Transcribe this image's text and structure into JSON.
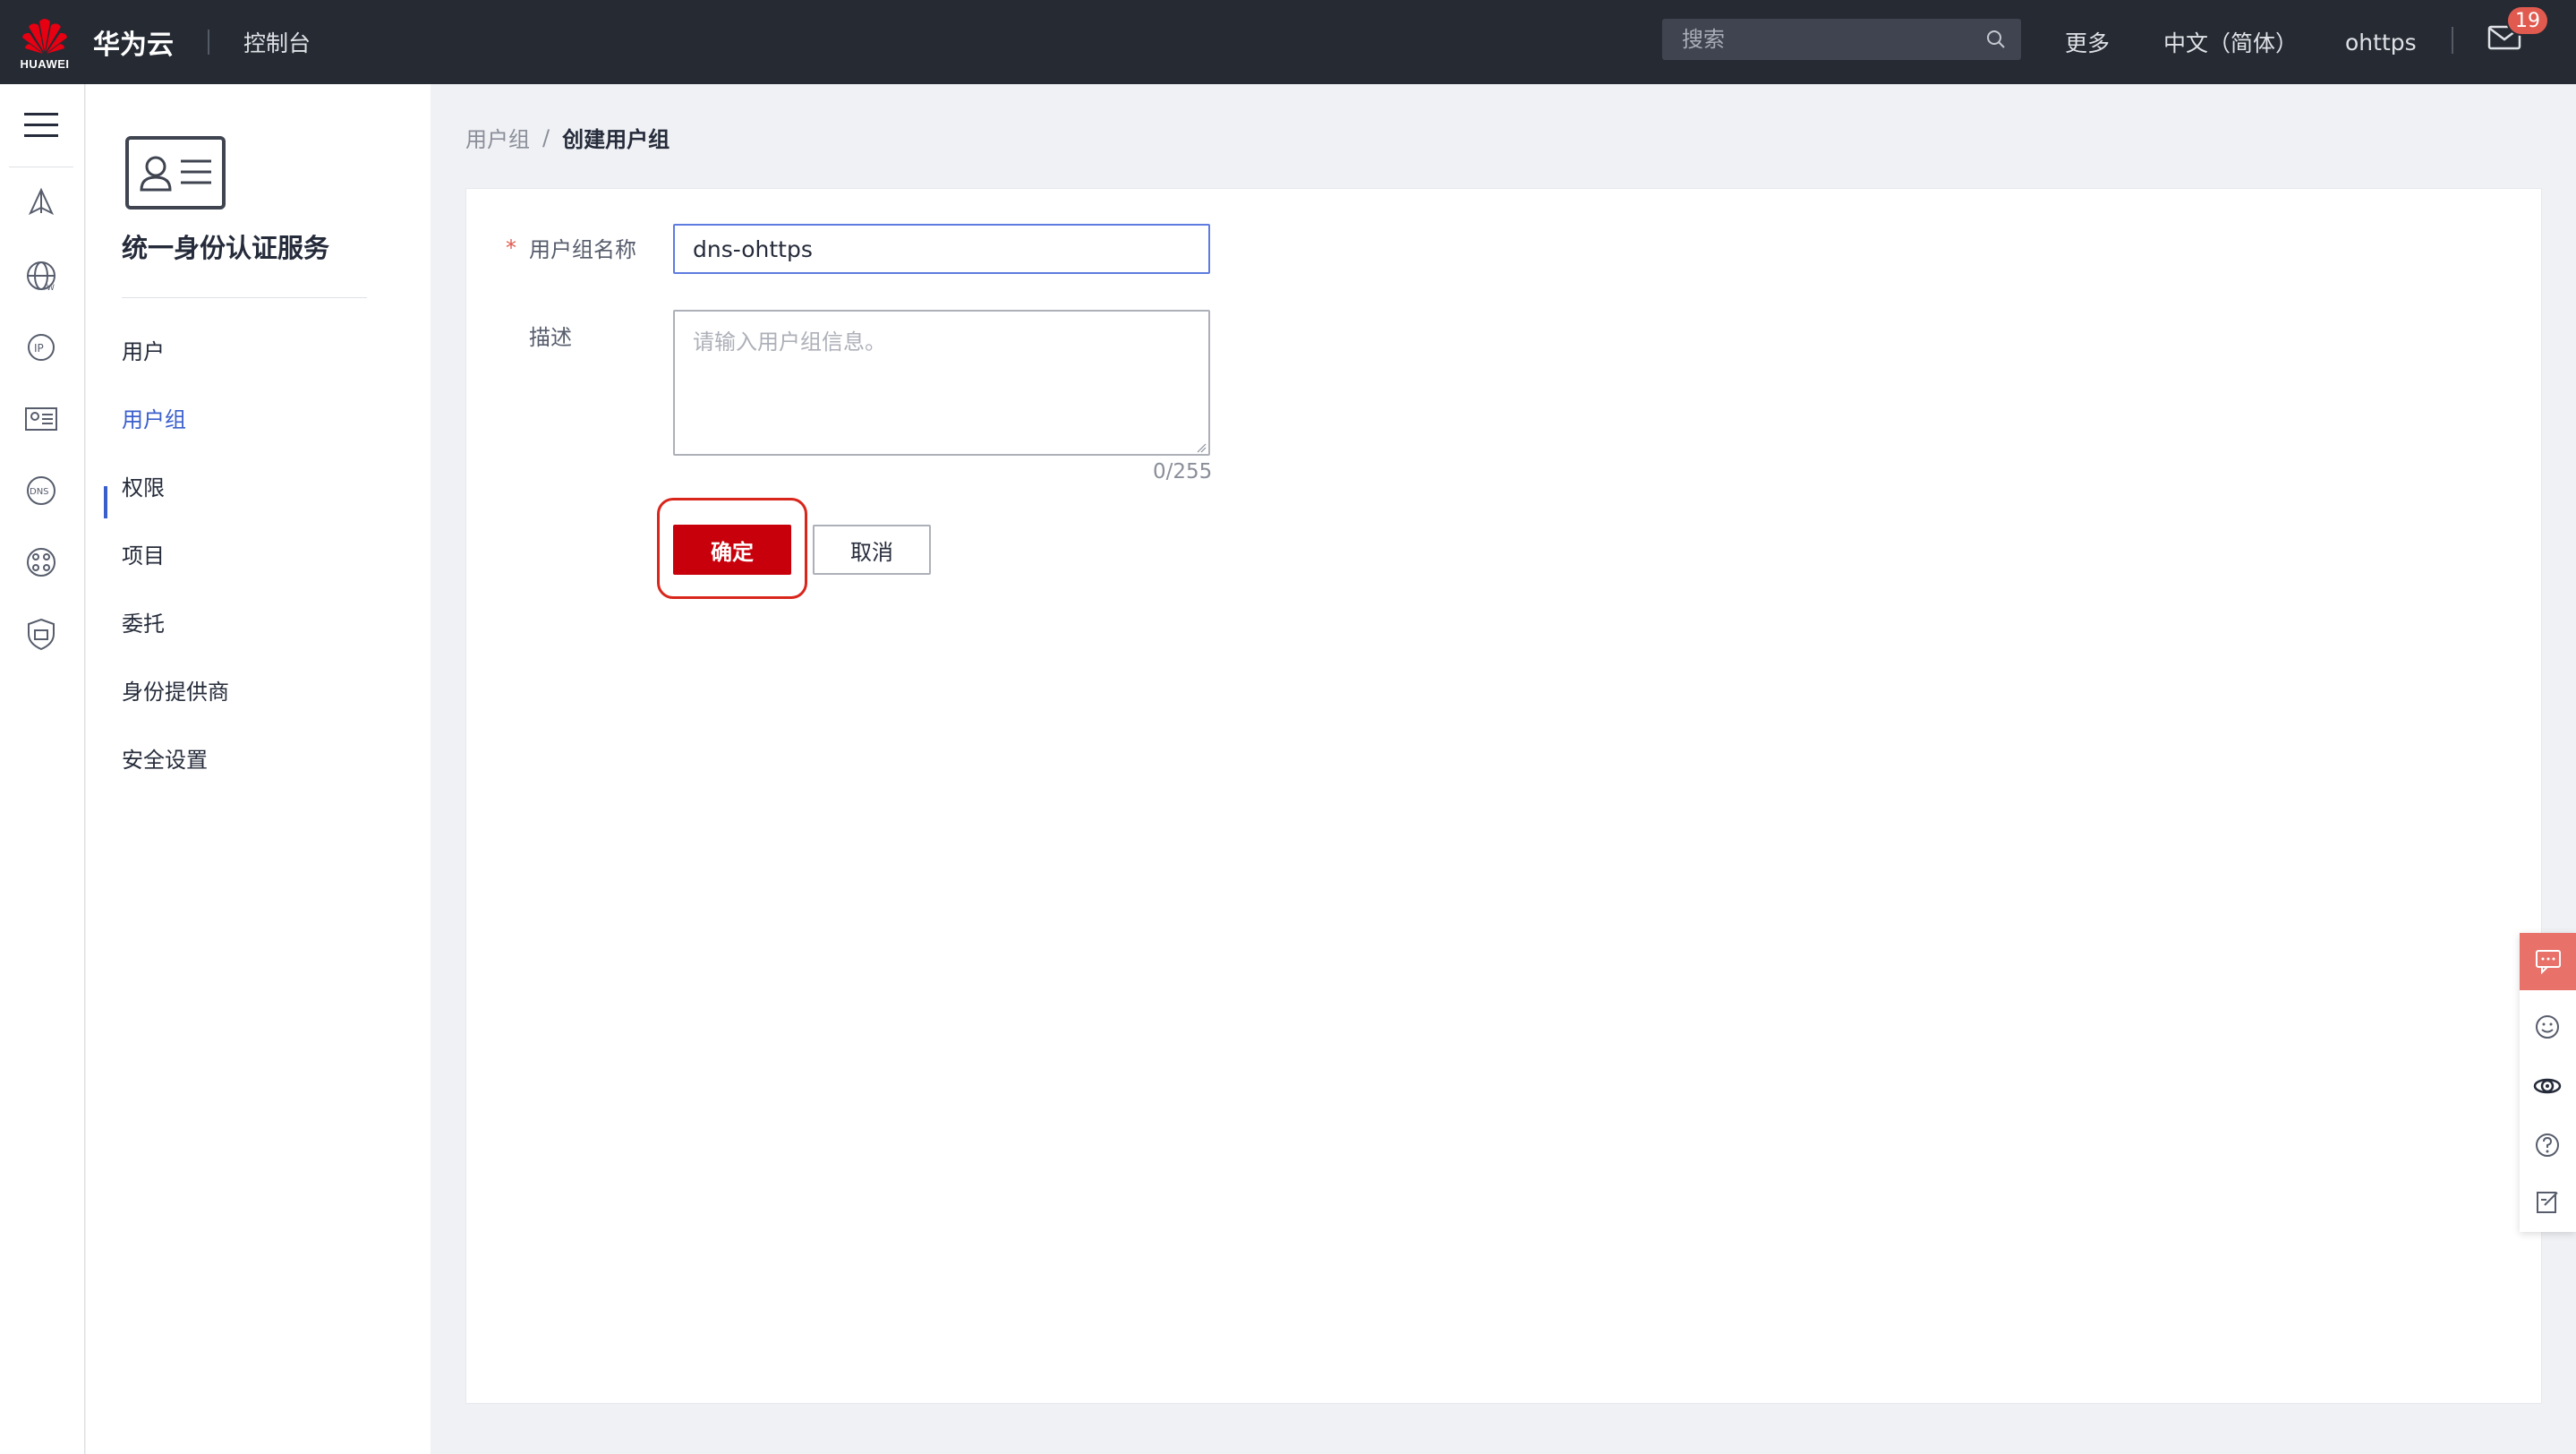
{
  "topbar": {
    "brand": "HUAWEI",
    "cloud_title": "华为云",
    "console": "控制台",
    "search_placeholder": "搜索",
    "more": "更多",
    "language": "中文（简体）",
    "username": "ohttps",
    "mail_badge": "19",
    "background": "#252a33"
  },
  "rail": {
    "icons": [
      "menu-icon",
      "deploy-icon",
      "globe-w-icon",
      "ip-icon",
      "id-card-icon",
      "dns-icon",
      "network-icon",
      "shield-icon"
    ]
  },
  "sidenav": {
    "service_title": "统一身份认证服务",
    "items": [
      {
        "label": "用户"
      },
      {
        "label": "用户组"
      },
      {
        "label": "权限"
      },
      {
        "label": "项目"
      },
      {
        "label": "委托"
      },
      {
        "label": "身份提供商"
      },
      {
        "label": "安全设置"
      }
    ],
    "active_item": "用户组",
    "accent": "#3a5fcd"
  },
  "breadcrumb": {
    "parent": "用户组",
    "separator": "/",
    "current": "创建用户组"
  },
  "form": {
    "required_mark": "*",
    "name_label": "用户组名称",
    "name_value": "dns-ohttps",
    "desc_label": "描述",
    "desc_placeholder": "请输入用户组信息。",
    "counter": "0/255",
    "ok_label": "确定",
    "cancel_label": "取消",
    "primary_color": "#c7000b"
  },
  "float_bar": {
    "icons": [
      "chat-icon",
      "smile-icon",
      "headset-icon",
      "help-icon",
      "edit-icon"
    ]
  }
}
